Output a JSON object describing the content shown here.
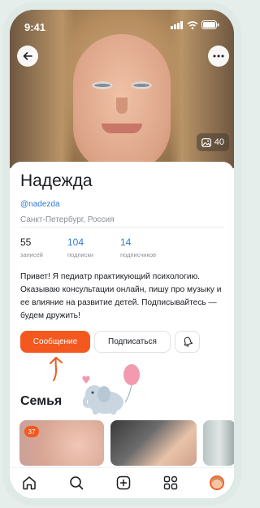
{
  "status_bar": {
    "time": "9:41"
  },
  "profile": {
    "name": "Надежда",
    "handle": "@nadezda",
    "location": "Санкт-Петербург, Россия",
    "photo_count": "40",
    "stats": [
      {
        "value": "55",
        "label": "записей"
      },
      {
        "value": "104",
        "label": "подписки"
      },
      {
        "value": "14",
        "label": "подписчиков"
      }
    ],
    "bio": "Привет! Я педиатр практикующий психологию. Оказываю консультации онлайн, пишу про музыку и ее влияние на развитие детей. Подписывайтесь — будем дружить!"
  },
  "actions": {
    "message_label": "Сообщение",
    "subscribe_label": "Подписаться"
  },
  "section": {
    "title": "Семья",
    "first_tile_badge": "37"
  },
  "colors": {
    "accent": "#f4581e",
    "link": "#2f7bd8"
  },
  "icons": {
    "back": "back-arrow-icon",
    "more": "more-dots-icon",
    "photos": "image-icon",
    "bell": "bell-icon",
    "tabs": [
      "home-icon",
      "search-icon",
      "add-icon",
      "apps-icon",
      "profile-avatar-icon"
    ]
  }
}
